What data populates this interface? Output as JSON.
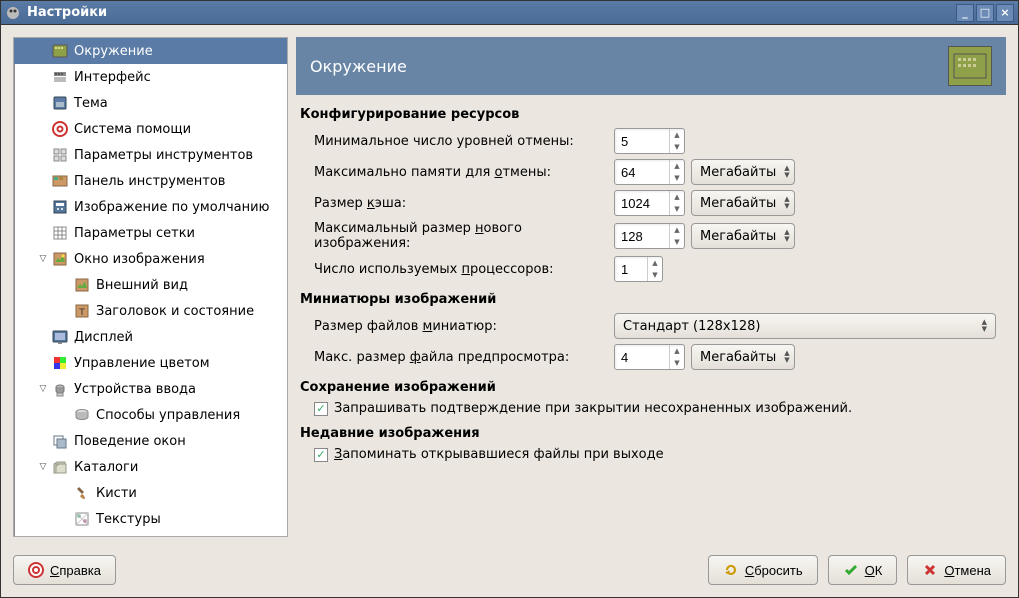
{
  "window": {
    "title": "Настройки"
  },
  "sidebar": {
    "items": [
      {
        "label": "Окружение",
        "indent": 1,
        "selected": true,
        "expander": ""
      },
      {
        "label": "Интерфейс",
        "indent": 1,
        "expander": ""
      },
      {
        "label": "Тема",
        "indent": 1,
        "expander": ""
      },
      {
        "label": "Система помощи",
        "indent": 1,
        "expander": ""
      },
      {
        "label": "Параметры инструментов",
        "indent": 1,
        "expander": ""
      },
      {
        "label": "Панель инструментов",
        "indent": 1,
        "expander": ""
      },
      {
        "label": "Изображение по умолчанию",
        "indent": 1,
        "expander": ""
      },
      {
        "label": "Параметры сетки",
        "indent": 1,
        "expander": ""
      },
      {
        "label": "Окно изображения",
        "indent": 1,
        "expander": "▽"
      },
      {
        "label": "Внешний вид",
        "indent": 2,
        "expander": ""
      },
      {
        "label": "Заголовок и состояние",
        "indent": 2,
        "expander": ""
      },
      {
        "label": "Дисплей",
        "indent": 1,
        "expander": ""
      },
      {
        "label": "Управление цветом",
        "indent": 1,
        "expander": ""
      },
      {
        "label": "Устройства ввода",
        "indent": 1,
        "expander": "▽"
      },
      {
        "label": "Способы управления",
        "indent": 2,
        "expander": ""
      },
      {
        "label": "Поведение окон",
        "indent": 1,
        "expander": ""
      },
      {
        "label": "Каталоги",
        "indent": 1,
        "expander": "▽"
      },
      {
        "label": "Кисти",
        "indent": 2,
        "expander": ""
      },
      {
        "label": "Текстуры",
        "indent": 2,
        "expander": ""
      }
    ]
  },
  "panel": {
    "title": "Окружение",
    "sections": {
      "resources": {
        "heading": "Конфигурирование ресурсов",
        "undo_levels_label": "Минимальное число уровней отмены:",
        "undo_levels_value": "5",
        "undo_memory_label_pre": "Максимально памяти для ",
        "undo_memory_label_u": "о",
        "undo_memory_label_post": "тмены:",
        "undo_memory_value": "64",
        "undo_memory_unit": "Мегабайты",
        "cache_label_pre": "Размер ",
        "cache_label_u": "к",
        "cache_label_post": "эша:",
        "cache_value": "1024",
        "cache_unit": "Мегабайты",
        "newimg_label_pre": "Максимальный размер ",
        "newimg_label_u": "н",
        "newimg_label_post": "ового изображения:",
        "newimg_value": "128",
        "newimg_unit": "Мегабайты",
        "cpu_label_pre": "Число используемых ",
        "cpu_label_u": "п",
        "cpu_label_post": "роцессоров:",
        "cpu_value": "1"
      },
      "thumbnails": {
        "heading": "Миниатюры изображений",
        "thumb_size_label_pre": "Размер файлов ",
        "thumb_size_label_u": "м",
        "thumb_size_label_post": "иниатюр:",
        "thumb_size_value": "Стандарт (128x128)",
        "thumb_max_label_pre": "Макс. размер ",
        "thumb_max_label_u": "ф",
        "thumb_max_label_post": "айла предпросмотра:",
        "thumb_max_value": "4",
        "thumb_max_unit": "Мегабайты"
      },
      "saving": {
        "heading": "Сохранение изображений",
        "confirm_label": "Запрашивать подтверждение при закрытии несохраненных изображений."
      },
      "recent": {
        "heading": "Недавние изображения",
        "remember_label_u": "З",
        "remember_label_post": "апоминать открывавшиеся файлы при выходе"
      }
    }
  },
  "buttons": {
    "help_u": "С",
    "help_post": "правка",
    "reset_u": "С",
    "reset_post": "бросить",
    "ok_u": "О",
    "ok_post": "К",
    "cancel_u": "О",
    "cancel_post": "тмена"
  }
}
